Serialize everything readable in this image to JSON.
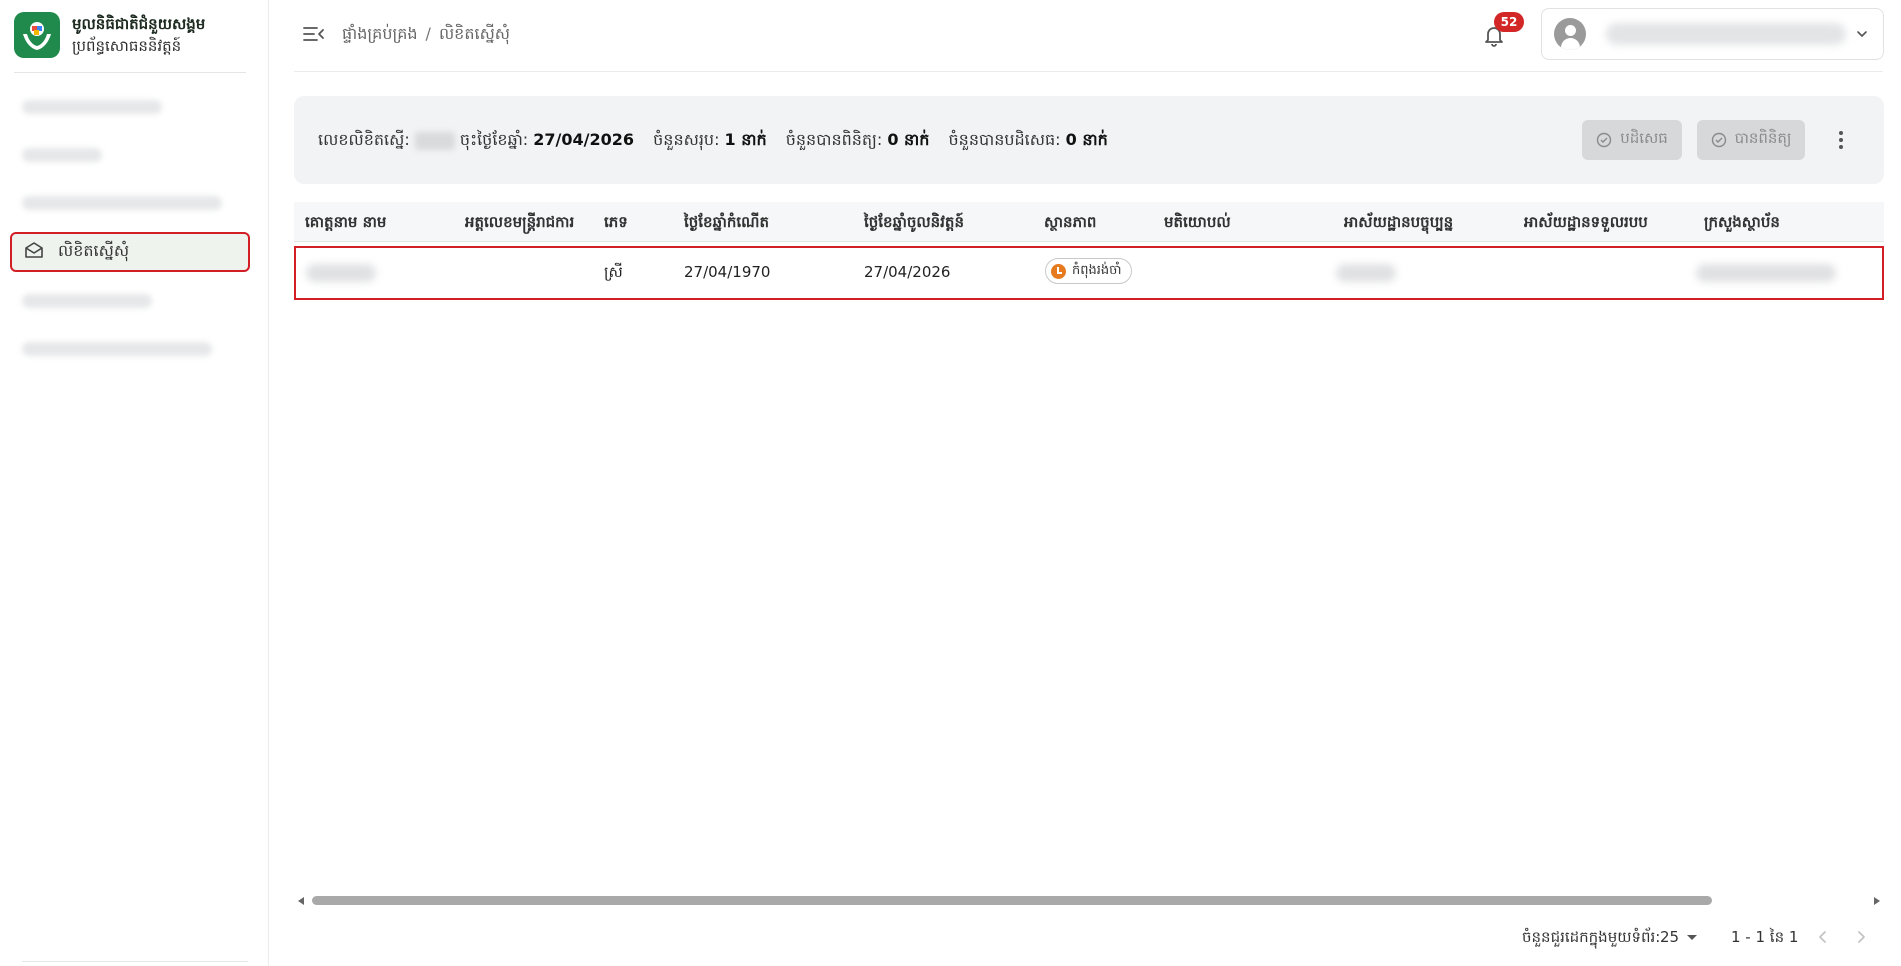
{
  "brand": {
    "title": "មូលនិធិជាតិជំនួយសង្គម",
    "subtitle": "ប្រព័ន្ធសោធននិវត្តន៍"
  },
  "sidebar": {
    "active_item": {
      "label": "លិខិតស្នើសុំ",
      "icon": "envelope-open-icon"
    }
  },
  "breadcrumb": {
    "items": [
      "ផ្ទាំងគ្រប់គ្រង",
      "លិខិតស្នើសុំ"
    ],
    "separator": "/"
  },
  "notifications": {
    "count": "52"
  },
  "info_bar": {
    "letter_no_label": "លេខលិខិតស្នើ:",
    "date_label": "ចុះថ្ងៃខែឆ្នាំ:",
    "date_value": "27/04/2026",
    "total_label": "ចំនួនសរុប:",
    "total_value": "1 នាក់",
    "checked_label": "ចំនួនបានពិនិត្យ:",
    "checked_value": "0 នាក់",
    "rejected_label": "ចំនួនបានបដិសេធ:",
    "rejected_value": "0 នាក់",
    "reject_button": "បដិសេធ",
    "check_button": "បានពិនិត្យ"
  },
  "table": {
    "columns": [
      "គោត្តនាម នាម",
      "អត្តលេខមន្ត្រីរាជការ",
      "ភេទ",
      "ថ្ងៃខែឆ្នាំកំណើត",
      "ថ្ងៃខែឆ្នាំចូលនិវត្តន៍",
      "ស្ថានភាព",
      "មតិយោបល់",
      "អាស័យដ្ឋានបច្ចុប្បន្ន",
      "អាស័យដ្ឋានទទួលរបប",
      "ក្រសួងស្ថាប័ន"
    ],
    "rows": [
      {
        "gender": "ស្រី",
        "birth_date": "27/04/1970",
        "retire_date": "27/04/2026",
        "status": "កំពុងរង់ចាំ"
      }
    ]
  },
  "pagination": {
    "rows_per_page_label": "ចំនួនជួរដេកក្នុងមួយទំព័រ:",
    "rows_per_page": "25",
    "range": "1 - 1 នៃ 1"
  },
  "colors": {
    "brand_green": "#1f8a4c",
    "highlight_red": "#d21e25",
    "badge_red": "#d32626",
    "status_orange": "#e57a1e"
  }
}
